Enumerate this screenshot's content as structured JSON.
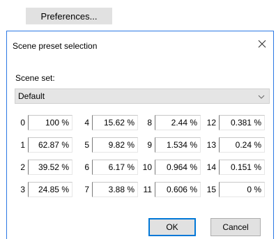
{
  "preferences_button": "Preferences...",
  "dialog": {
    "title": "Scene preset selection",
    "scene_set_label": "Scene set:",
    "scene_set_value": "Default",
    "ok_label": "OK",
    "cancel_label": "Cancel",
    "presets": [
      {
        "index": "0",
        "value": "100 %"
      },
      {
        "index": "1",
        "value": "62.87 %"
      },
      {
        "index": "2",
        "value": "39.52 %"
      },
      {
        "index": "3",
        "value": "24.85 %"
      },
      {
        "index": "4",
        "value": "15.62 %"
      },
      {
        "index": "5",
        "value": "9.82 %"
      },
      {
        "index": "6",
        "value": "6.17 %"
      },
      {
        "index": "7",
        "value": "3.88 %"
      },
      {
        "index": "8",
        "value": "2.44 %"
      },
      {
        "index": "9",
        "value": "1.534 %"
      },
      {
        "index": "10",
        "value": "0.964 %"
      },
      {
        "index": "11",
        "value": "0.606 %"
      },
      {
        "index": "12",
        "value": "0.381 %"
      },
      {
        "index": "13",
        "value": "0.24 %"
      },
      {
        "index": "14",
        "value": "0.151 %"
      },
      {
        "index": "15",
        "value": "0 %"
      }
    ]
  }
}
